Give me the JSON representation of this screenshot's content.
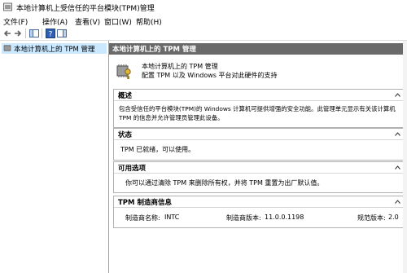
{
  "window": {
    "title": "本地计算机上受信任的平台模块(TPM)管理"
  },
  "menu": {
    "items": [
      "文件(F)",
      "操作(A)",
      "查看(V)",
      "窗口(W)",
      "帮助(H)"
    ]
  },
  "tree": {
    "selected_item": "本地计算机上的 TPM 管理"
  },
  "header": {
    "title": "本地计算机上的 TPM 管理"
  },
  "intro": {
    "line1": "本地计算机上的 TPM 管理",
    "line2": "配置 TPM 以及 Windows 平台对此硬件的支持"
  },
  "overview": {
    "title": "概述",
    "line1": "包含受信任的平台模块(TPM)的 Windows 计算机可提供增强的安全功能。此管理单元显示有关该计算机",
    "line2": "TPM 的信息并允许管理员管理此设备。"
  },
  "status": {
    "title": "状态",
    "text": "TPM 已就绪，可以使用。"
  },
  "options": {
    "title": "可用选项",
    "text": "你可以通过清除 TPM 来删除所有权，并将 TPM 重置为出厂默认值。"
  },
  "manufacturer": {
    "title": "TPM 制造商信息",
    "name_label": "制造商名称:",
    "name_value": "INTC",
    "version_label": "制造商版本:",
    "version_value": "11.0.0.1198",
    "spec_label": "规范版本:",
    "spec_value": "2.0"
  },
  "colors": {
    "header_bg": "#6a6a6a",
    "selection_bg": "#cce8ff",
    "section_border": "#b0b0b0"
  }
}
